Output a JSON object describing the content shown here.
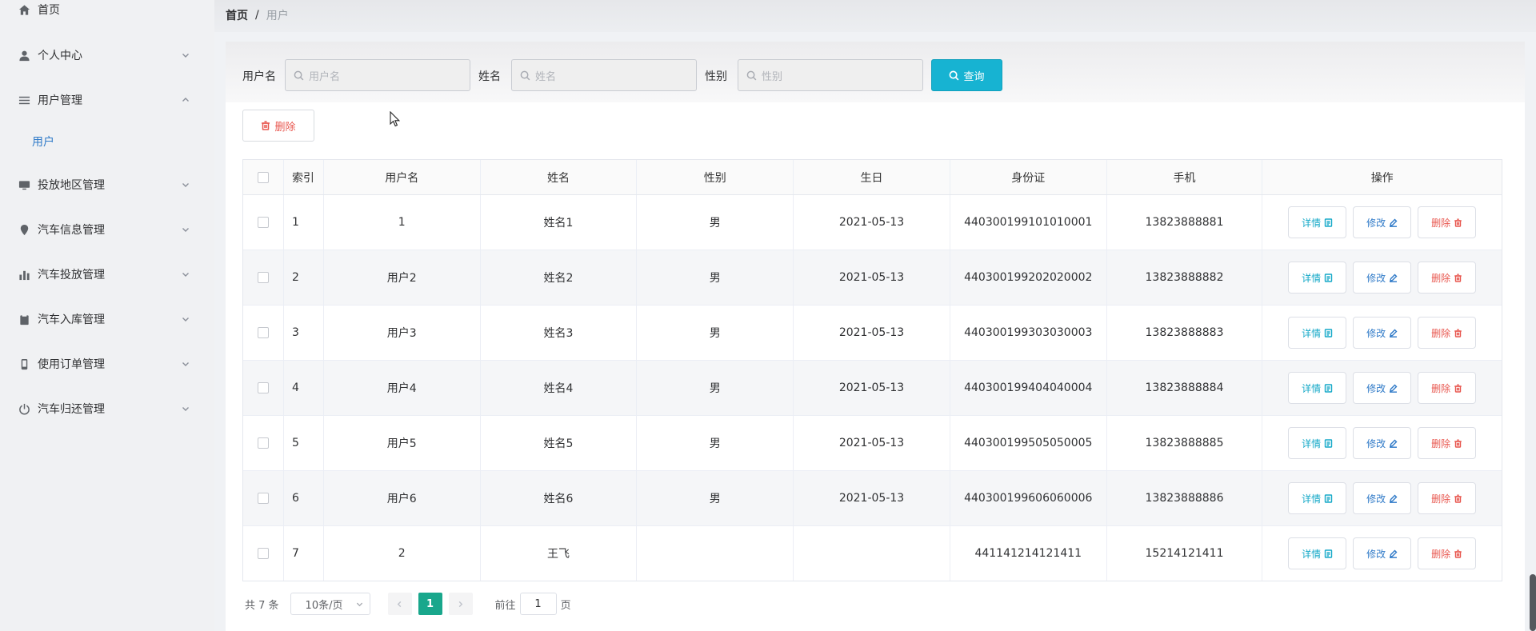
{
  "breadcrumb": {
    "home": "首页",
    "separator": "/",
    "current": "用户"
  },
  "sidebar": {
    "items": [
      {
        "label": "首页",
        "icon": "home-icon"
      },
      {
        "label": "个人中心",
        "icon": "user-icon"
      },
      {
        "label": "用户管理",
        "icon": "list-icon",
        "expanded": true
      },
      {
        "label": "投放地区管理",
        "icon": "monitor-icon"
      },
      {
        "label": "汽车信息管理",
        "icon": "location-icon"
      },
      {
        "label": "汽车投放管理",
        "icon": "bar-chart-icon"
      },
      {
        "label": "汽车入库管理",
        "icon": "clipboard-icon"
      },
      {
        "label": "使用订单管理",
        "icon": "phone-icon"
      },
      {
        "label": "汽车归还管理",
        "icon": "power-icon"
      }
    ],
    "subitem": "用户"
  },
  "search": {
    "username_label": "用户名",
    "username_placeholder": "用户名",
    "name_label": "姓名",
    "name_placeholder": "姓名",
    "gender_label": "性别",
    "gender_placeholder": "性别",
    "query_label": "查询"
  },
  "toolbar": {
    "delete_label": "删除"
  },
  "table": {
    "headers": [
      "索引",
      "用户名",
      "姓名",
      "性别",
      "生日",
      "身份证",
      "手机",
      "操作"
    ],
    "rows": [
      {
        "index": "1",
        "username": "1",
        "name": "姓名1",
        "gender": "男",
        "birthday": "2021-05-13",
        "idcard": "440300199101010001",
        "phone": "13823888881"
      },
      {
        "index": "2",
        "username": "用户2",
        "name": "姓名2",
        "gender": "男",
        "birthday": "2021-05-13",
        "idcard": "440300199202020002",
        "phone": "13823888882"
      },
      {
        "index": "3",
        "username": "用户3",
        "name": "姓名3",
        "gender": "男",
        "birthday": "2021-05-13",
        "idcard": "440300199303030003",
        "phone": "13823888883"
      },
      {
        "index": "4",
        "username": "用户4",
        "name": "姓名4",
        "gender": "男",
        "birthday": "2021-05-13",
        "idcard": "440300199404040004",
        "phone": "13823888884"
      },
      {
        "index": "5",
        "username": "用户5",
        "name": "姓名5",
        "gender": "男",
        "birthday": "2021-05-13",
        "idcard": "440300199505050005",
        "phone": "13823888885"
      },
      {
        "index": "6",
        "username": "用户6",
        "name": "姓名6",
        "gender": "男",
        "birthday": "2021-05-13",
        "idcard": "440300199606060006",
        "phone": "13823888886"
      },
      {
        "index": "7",
        "username": "2",
        "name": "王飞",
        "gender": "",
        "birthday": "",
        "idcard": "441141214121411",
        "phone": "15214121411"
      }
    ],
    "actions": {
      "detail": "详情",
      "edit": "修改",
      "delete": "删除"
    }
  },
  "pagination": {
    "total": "共 7 条",
    "page_size": "10条/页",
    "current_page": "1",
    "goto_label": "前往",
    "goto_value": "1",
    "goto_unit": "页"
  },
  "colors": {
    "accent": "#17b3d2",
    "link": "#2f7ac8",
    "danger": "#e8574f",
    "pager_active": "#19a78c"
  }
}
